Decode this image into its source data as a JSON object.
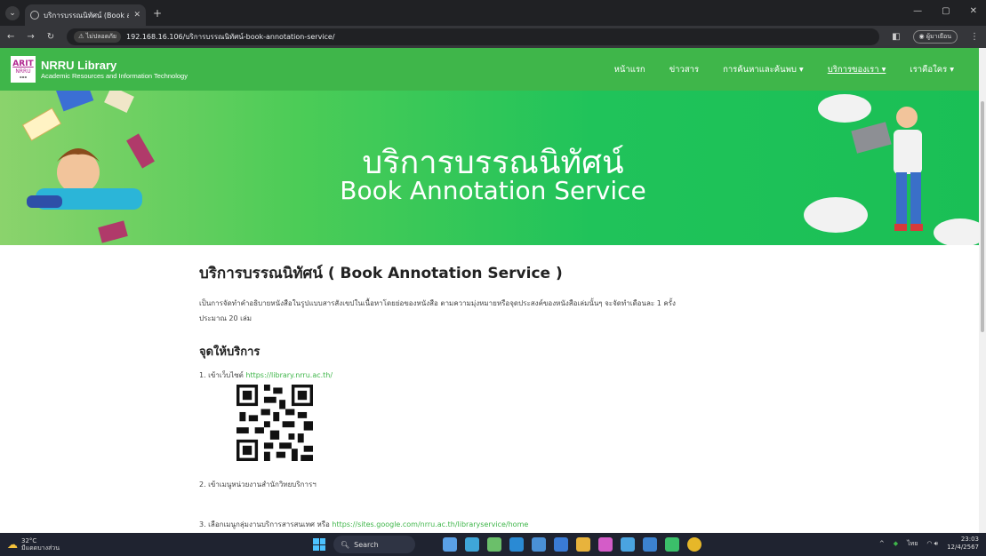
{
  "browser": {
    "tab_title": "บริการบรรณนิทัศน์ (Book annotati",
    "new_tab": "+",
    "security_label": "ไม่ปลอดภัย",
    "url": "192.168.16.106/บริการบรรณนิทัศน์-book-annotation-service/",
    "profile_label": "ผู้มาเยือน",
    "colors": {
      "chrome": "#202124",
      "toolbar": "#35363a"
    }
  },
  "site": {
    "logo_text": "ARIT",
    "brand_name": "NRRU Library",
    "brand_sub": "Academic Resources and Information Technology",
    "menu": [
      {
        "label": "หน้าแรก"
      },
      {
        "label": "ข่าวสาร"
      },
      {
        "label": "การค้นหาและค้นพบ ▾"
      },
      {
        "label": "บริการของเรา ▾"
      },
      {
        "label": "เราคือใคร ▾"
      }
    ],
    "colors": {
      "primary": "#3fb64a",
      "link": "#3fb64a"
    }
  },
  "banner": {
    "title_th": "บริการบรรณนิทัศน์",
    "title_en": "Book Annotation Service"
  },
  "content": {
    "heading": "บริการบรรณนิทัศน์ ( Book Annotation Service )",
    "description_line1": "เป็นการจัดทำคำอธิบายหนังสือในรูปแบบสารสังเขปในเนื้อหาโดยย่อของหนังสือ ตามความมุ่งหมายหรือจุดประสงค์ของหนังสือเล่มนั้นๆ จะจัดทำเดือนละ 1 ครั้ง",
    "description_line2": "ประมาณ 20 เล่ม",
    "subheading": "จุดให้บริการ",
    "step1_prefix": "1. เข้าเว็บไซต์ ",
    "step1_link": "https://library.nrru.ac.th/",
    "step2": "2. เข้าเมนูหน่วยงานสำนักวิทยบริการฯ",
    "step3_prefix": "3. เลือกเมนูกลุ่มงานบริการสารสนเทศ หรือ ",
    "step3_link": "https://sites.google.com/nrru.ac.th/libraryservice/home"
  },
  "taskbar": {
    "temperature": "32°C",
    "weather_text": "มีแดดบางส่วน",
    "search_placeholder": "Search",
    "lang": "ไทย",
    "time": "23:03",
    "date": "12/4/2567"
  }
}
